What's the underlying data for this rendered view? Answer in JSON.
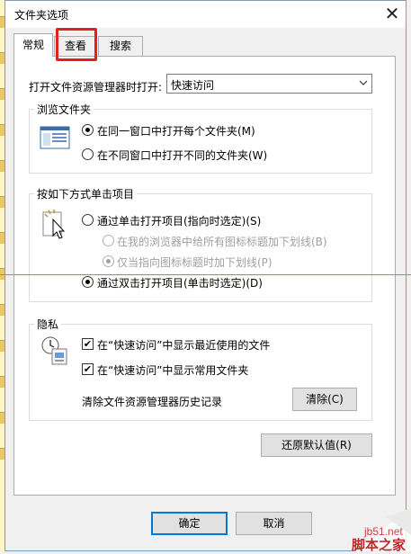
{
  "window": {
    "title": "文件夹选项",
    "close_glyph": "✕"
  },
  "tabs": [
    {
      "label": "常规"
    },
    {
      "label": "查看"
    },
    {
      "label": "搜索"
    }
  ],
  "highlight_color": "#e3201b",
  "open_explorer": {
    "label": "打开文件资源管理器时打开:",
    "selected": "快速访问"
  },
  "browse_folders": {
    "title": "浏览文件夹",
    "icon": "folder-window-icon",
    "options": [
      {
        "label": "在同一窗口中打开每个文件夹(M)",
        "checked": true
      },
      {
        "label": "在不同窗口中打开不同的文件夹(W)",
        "checked": false
      }
    ]
  },
  "click_items": {
    "title": "按如下方式单击项目",
    "icon": "mouse-pointer-icon",
    "options": [
      {
        "label": "通过单击打开项目(指向时选定)(S)",
        "checked": false,
        "enabled": true
      },
      {
        "label": "在我的浏览器中给所有图标标题加下划线(B)",
        "checked": false,
        "enabled": false
      },
      {
        "label": "仅当指向图标标题时加下划线(P)",
        "checked": true,
        "enabled": false
      },
      {
        "label": "通过双击打开项目(单击时选定)(D)",
        "checked": true,
        "enabled": true
      }
    ]
  },
  "privacy": {
    "title": "隐私",
    "icon": "clock-documents-icon",
    "checks": [
      {
        "label": "在“快速访问”中显示最近使用的文件",
        "checked": true
      },
      {
        "label": "在“快速访问”中显示常用文件夹",
        "checked": true
      }
    ],
    "clear_history_label": "清除文件资源管理器历史记录",
    "clear_button": "清除(C)"
  },
  "buttons": {
    "restore_defaults": "还原默认值(R)",
    "ok": "确定",
    "cancel": "取消"
  },
  "watermark": {
    "site": "jb51.net",
    "name": "脚本之家"
  }
}
